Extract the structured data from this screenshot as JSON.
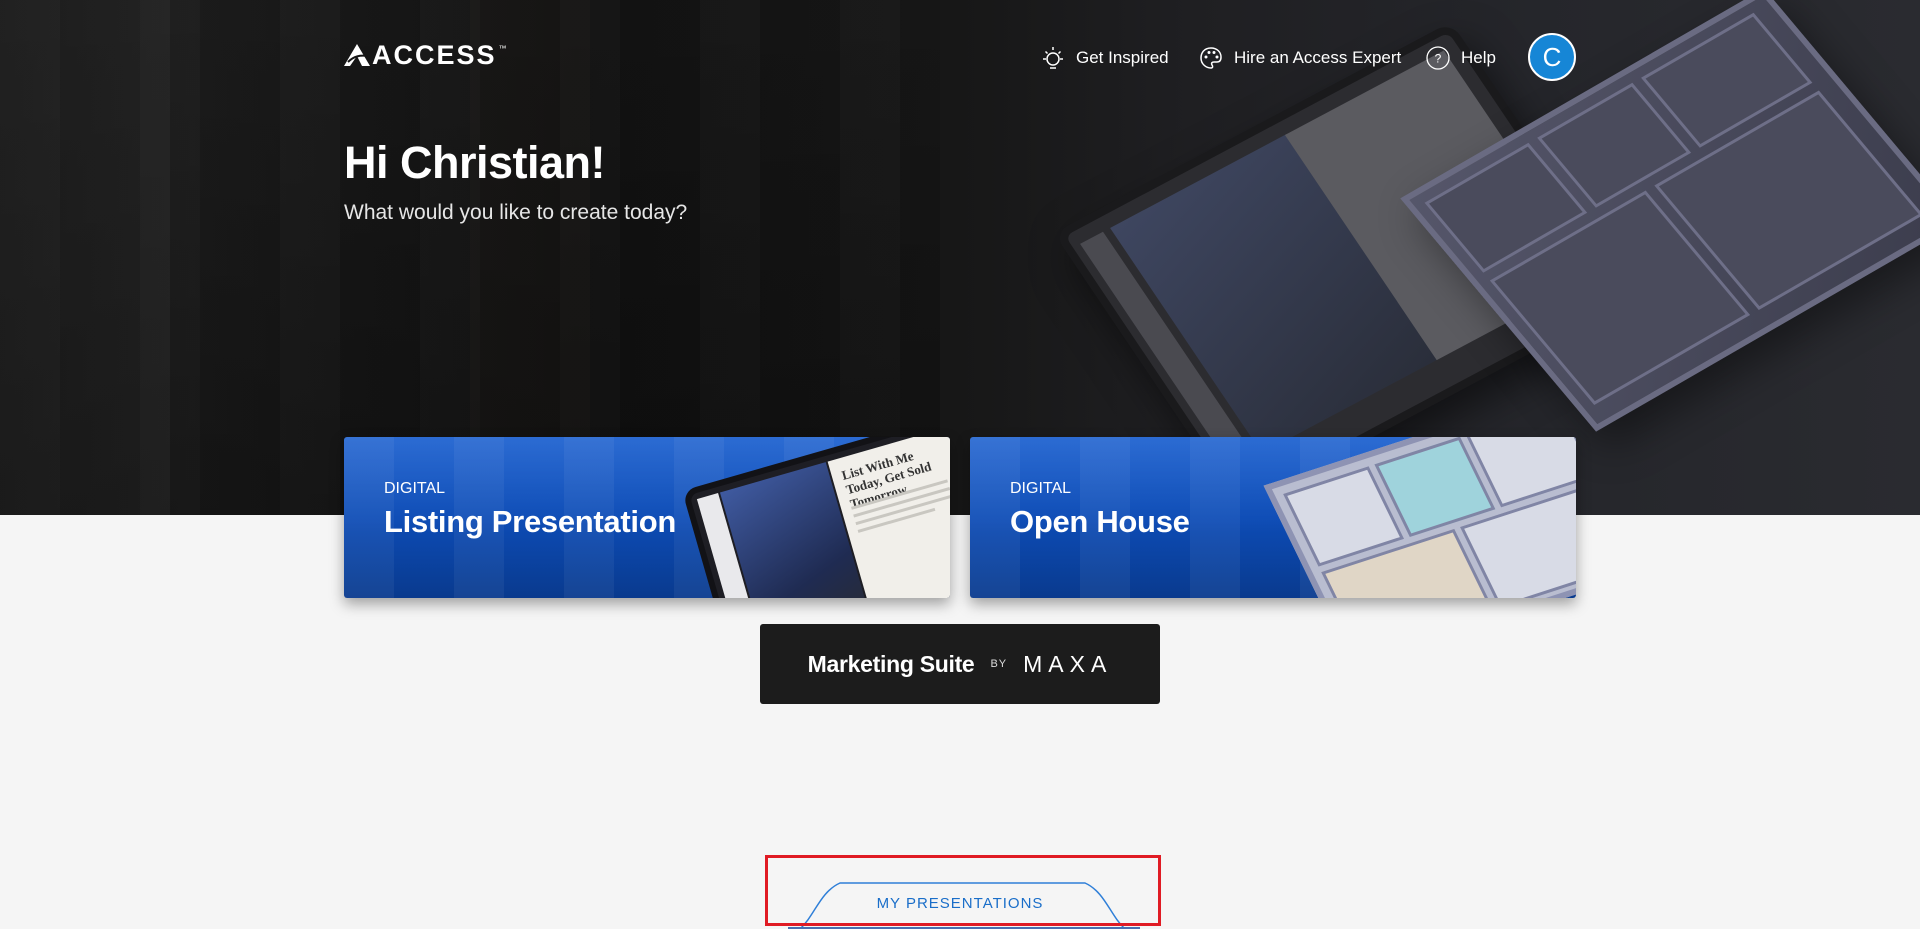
{
  "header": {
    "logo_text": "ACCESS",
    "logo_tm": "™",
    "nav": [
      {
        "label": "Get Inspired",
        "icon": "lightbulb-icon"
      },
      {
        "label": "Hire an Access Expert",
        "icon": "palette-icon"
      },
      {
        "label": "Help",
        "icon": "help-icon"
      }
    ],
    "avatar_initial": "C"
  },
  "hero": {
    "greeting": "Hi Christian!",
    "subtitle": "What would you like to create today?"
  },
  "cards": [
    {
      "kicker": "DIGITAL",
      "title": "Listing Presentation",
      "tablet_headline": "List With Me Today, Get Sold Tomorrow."
    },
    {
      "kicker": "DIGITAL",
      "title": "Open House"
    }
  ],
  "marketing_suite": {
    "label": "Marketing Suite",
    "by": "BY",
    "brand": "MAXA"
  },
  "tabs": {
    "my_presentations": "MY PRESENTATIONS"
  },
  "colors": {
    "accent_blue": "#1686d6",
    "card_blue": "#0d4cb6",
    "link_blue": "#1a6ec9",
    "highlight_red": "#e01b24"
  }
}
